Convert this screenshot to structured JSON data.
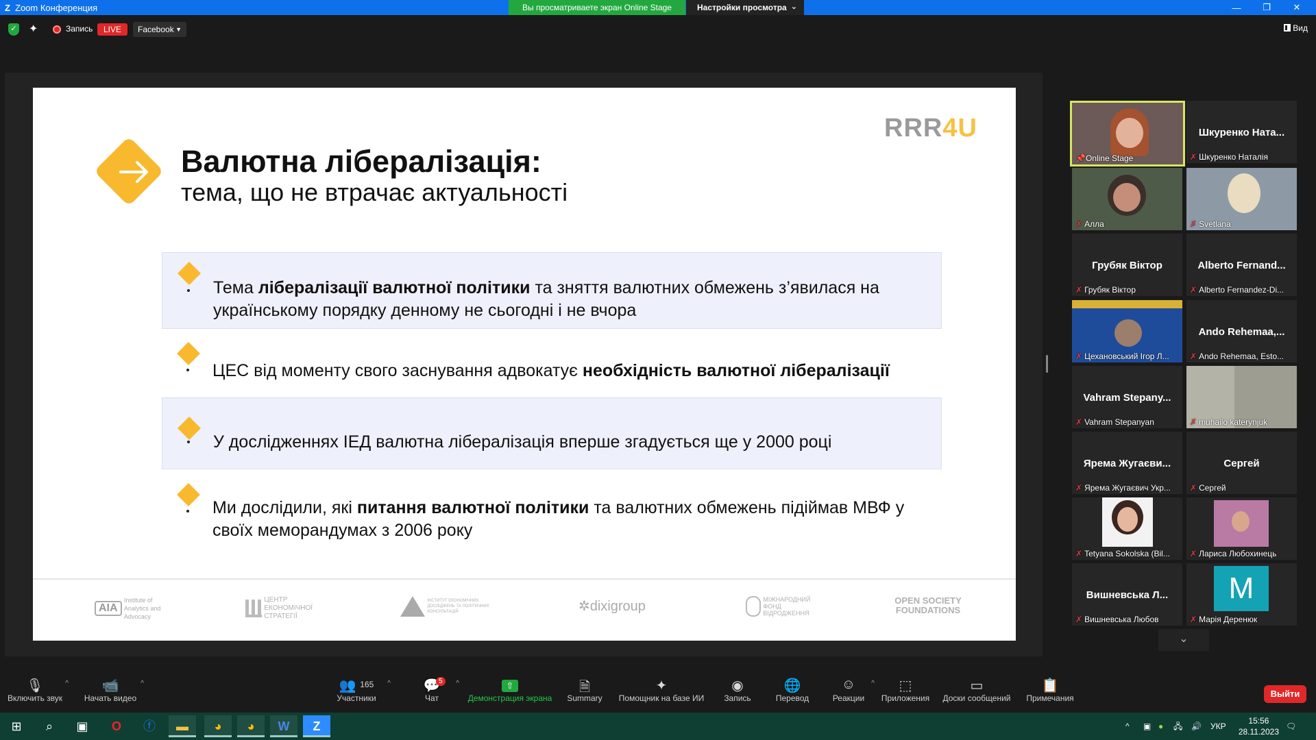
{
  "window": {
    "title": "Zoom Конференция",
    "share_notice": "Вы просматриваете экран Online Stage",
    "view_settings": "Настройки просмотра"
  },
  "topbar": {
    "record_label": "Запись",
    "live_label": "LIVE",
    "stream_target": "Facebook",
    "view_label": "Вид"
  },
  "slide": {
    "brand_prefix": "RRR",
    "brand_suffix": "4U",
    "title": "Валютна лібералізація:",
    "subtitle": "тема, що не втрачає актуальності",
    "bullets": [
      {
        "pre": "Тема ",
        "bold": "лібералізації валютної політики",
        "post": " та зняття валютних обмежень з’явилася на українському порядку денному не сьогодні і не вчора"
      },
      {
        "pre": "ЦЕС від моменту свого заснування адвокатує ",
        "bold": "необхідність валютної лібералізації",
        "post": ""
      },
      {
        "pre": "У дослідженнях ІЕД валютна лібералізація вперше згадується ще у 2000 році",
        "bold": "",
        "post": ""
      },
      {
        "pre": "Ми дослідили, які ",
        "bold": "питання валютної політики",
        "post": " та валютних обмежень підіймав МВФ у своїх меморандумах з 2006 року"
      }
    ],
    "partners": [
      {
        "mark": "AIA",
        "text": "Institute of Analytics and Advocacy"
      },
      {
        "mark": "",
        "text": "ЦЕНТР ЕКОНОМІЧНОЇ СТРАТЕГІЇ"
      },
      {
        "mark": "",
        "text": "ІНСТИТУТ ЕКОНОМІЧНИХ ДОСЛІДЖЕНЬ ТА ПОЛІТИЧНИХ КОНСУЛЬТАЦІЙ"
      },
      {
        "mark": "",
        "text": "dixigroup"
      },
      {
        "mark": "",
        "text": "МІЖНАРОДНИЙ ФОНД ВІДРОДЖЕННЯ"
      },
      {
        "mark": "",
        "text": "OPEN SOCIETY FOUNDATIONS"
      }
    ]
  },
  "participants": [
    {
      "name": "",
      "label": "Online Stage",
      "video": true,
      "pinned": true
    },
    {
      "name": "Шкуренко  Ната...",
      "label": "Шкуренко Наталія",
      "video": false
    },
    {
      "name": "",
      "label": "Алла",
      "video": true
    },
    {
      "name": "",
      "label": "Svetlana",
      "video": true
    },
    {
      "name": "Грубяк Віктор",
      "label": "Грубяк Віктор",
      "video": false
    },
    {
      "name": "Alberto  Fernand...",
      "label": "Alberto Fernandez-Di...",
      "video": false
    },
    {
      "name": "",
      "label": "Цехановський Ігор Л...",
      "video": true
    },
    {
      "name": "Ando  Rehemaa,...",
      "label": "Ando Rehemaa, Esto...",
      "video": false
    },
    {
      "name": "Vahram  Stepany...",
      "label": "Vahram Stepanyan",
      "video": false
    },
    {
      "name": "",
      "label": "muhailo katerynjuk",
      "video": true
    },
    {
      "name": "Ярема  Жугаєви...",
      "label": "Ярема Жугаєвич Укр...",
      "video": false
    },
    {
      "name": "Сергей",
      "label": "Сергей",
      "video": false
    },
    {
      "name": "",
      "label": "Tetyana Sokolska (Bil...",
      "video": true
    },
    {
      "name": "",
      "label": "Лариса Любохинець",
      "video": true
    },
    {
      "name": "Вишневська  Л...",
      "label": "Вишневська Любов",
      "video": false
    },
    {
      "name": "",
      "label": "Марія Деренюк",
      "video": true,
      "avatar_letter": "M"
    }
  ],
  "toolbar": {
    "unmute": "Включить звук",
    "start_video": "Начать видео",
    "participants": "Участники",
    "participants_count": "165",
    "chat": "Чат",
    "chat_badge": "5",
    "share": "Демонстрация экрана",
    "summary": "Summary",
    "ai": "Помощник на базе ИИ",
    "record": "Запись",
    "translate": "Перевод",
    "reactions": "Реакции",
    "apps": "Приложения",
    "whiteboards": "Доски сообщений",
    "notes": "Примечания",
    "leave": "Выйти"
  },
  "taskbar": {
    "lang": "УКР",
    "time": "15:56",
    "date": "28.11.2023"
  },
  "colors": {
    "zoom_blue": "#0e71eb",
    "share_green": "#23a83f",
    "accent_yellow": "#f8b92f",
    "leave_red": "#e02828",
    "taskbar": "#0f3f32"
  }
}
